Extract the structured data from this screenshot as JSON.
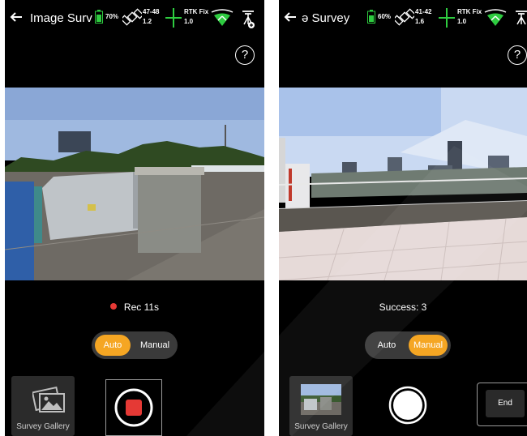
{
  "left": {
    "title": "Image Surv",
    "battery": "70%",
    "sat_top": "47-48",
    "sat_bottom": "1.2",
    "rtk_label": "RTK Fix",
    "rtk_value": "1.0",
    "help": "?",
    "rec_text": "Rec 11s",
    "mode_options": [
      "Auto",
      "Manual"
    ],
    "active_mode": "Auto",
    "gallery_label": "Survey Gallery"
  },
  "right": {
    "title": "ə Survey",
    "battery": "60%",
    "sat_top": "41-42",
    "sat_bottom": "1.6",
    "rtk_label": "RTK Fix",
    "rtk_value": "1.0",
    "help": "?",
    "status_text": "Success: 3",
    "mode_options": [
      "Auto",
      "Manual"
    ],
    "active_mode": "Manual",
    "gallery_label": "Survey Gallery",
    "end_label": "End"
  },
  "colors": {
    "accent": "#f5a623",
    "record_red": "#e53935",
    "battery_green": "#2ecc40",
    "rtk_green": "#2ecc40"
  }
}
